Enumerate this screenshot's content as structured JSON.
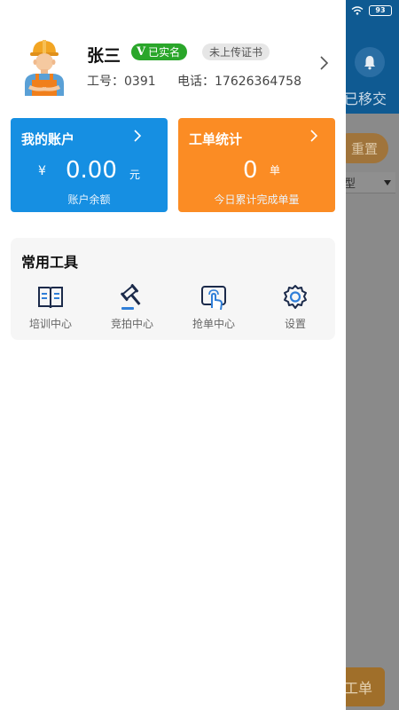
{
  "status_bar": {
    "battery": "93"
  },
  "background": {
    "transfer_tab": "已移交",
    "reset_button": "重置",
    "type_filter": "型",
    "order_button": "工单"
  },
  "profile": {
    "name": "张三",
    "verified_badge": "已实名",
    "verified_mark": "V",
    "cert_badge": "未上传证书",
    "work_no": "工号：0391",
    "phone": "电话：17626364758"
  },
  "account_card": {
    "title": "我的账户",
    "currency": "¥",
    "balance": "0.00",
    "unit": "元",
    "caption": "账户余额",
    "color": "#168fe2"
  },
  "orders_card": {
    "title": "工单统计",
    "count": "0",
    "unit": "单",
    "caption": "今日累计完成单量",
    "color": "#fb8c24"
  },
  "tools": {
    "title": "常用工具",
    "items": [
      {
        "label": "培训中心",
        "icon": "book-icon"
      },
      {
        "label": "竞拍中心",
        "icon": "gavel-icon"
      },
      {
        "label": "抢单中心",
        "icon": "tap-screen-icon"
      },
      {
        "label": "设置",
        "icon": "gear-icon"
      }
    ]
  }
}
